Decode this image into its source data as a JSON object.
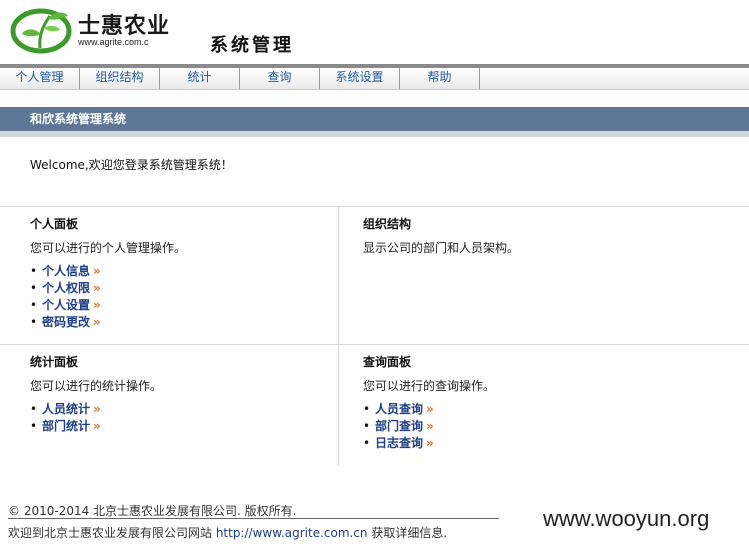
{
  "header": {
    "logo_name": "士惠农业",
    "logo_url": "www.agrite.com.c",
    "system_title": "系统管理"
  },
  "nav": {
    "items": [
      {
        "label": "个人管理"
      },
      {
        "label": "组织结构"
      },
      {
        "label": "统计"
      },
      {
        "label": "查询"
      },
      {
        "label": "系统设置"
      },
      {
        "label": "帮助"
      }
    ]
  },
  "band": {
    "title": "和欣系统管理系统"
  },
  "welcome": "Welcome,欢迎您登录系统管理系统！",
  "panels": {
    "personal": {
      "title": "个人面板",
      "desc": "您可以进行的个人管理操作。",
      "links": [
        "个人信息",
        "个人权限",
        "个人设置",
        "密码更改"
      ]
    },
    "org": {
      "title": "组织结构",
      "desc": "显示公司的部门和人员架构。"
    },
    "stats": {
      "title": "统计面板",
      "desc": "您可以进行的统计操作。",
      "links": [
        "人员统计",
        "部门统计"
      ]
    },
    "query": {
      "title": "查询面板",
      "desc": "您可以进行的查询操作。",
      "links": [
        "人员查询",
        "部门查询",
        "日志查询"
      ]
    }
  },
  "bullet": "•",
  "raquo": "»",
  "footer": {
    "copyright": "© 2010-2014 北京士惠农业发展有限公司. 版权所有.",
    "prefix": "欢迎到北京士惠农业发展有限公司网站 ",
    "link": "http://www.agrite.com.cn",
    "suffix": " 获取详细信息."
  },
  "watermark": "www.wooyun.org",
  "colors": {
    "band": "#5e7799",
    "link": "#1f3f8a",
    "nav_link": "#1f5aa6",
    "accent": "#e07020",
    "logo_green": "#3a9a2a"
  }
}
